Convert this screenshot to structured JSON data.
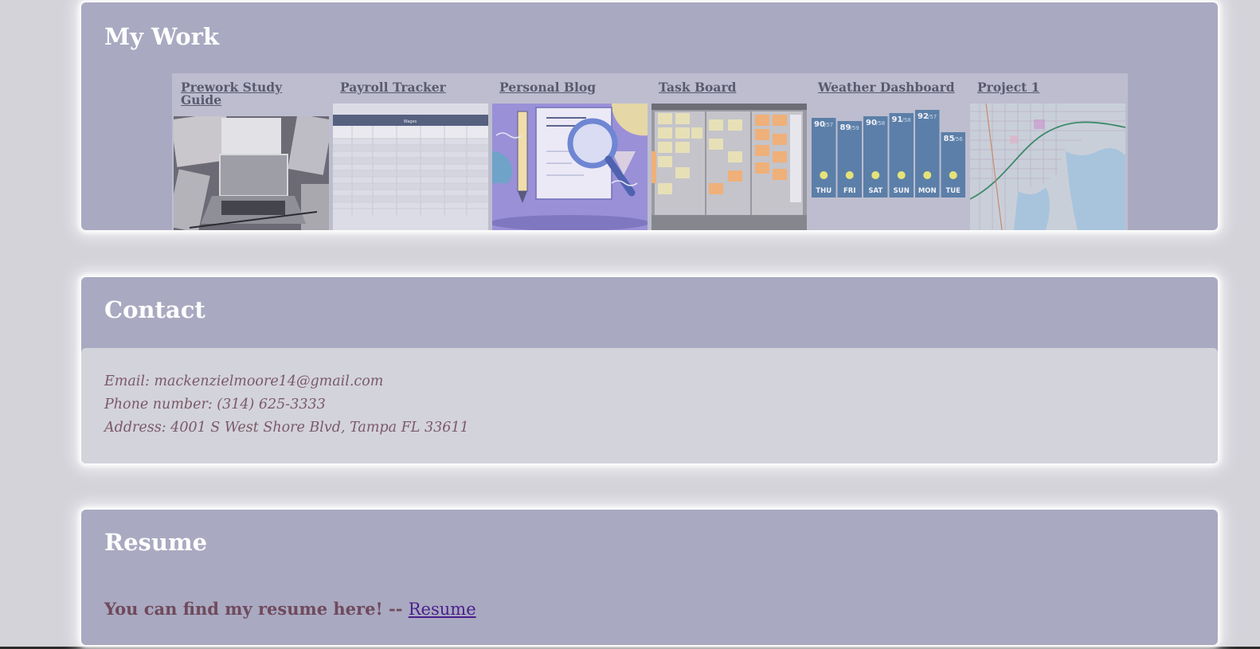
{
  "work": {
    "title": "My Work",
    "projects": [
      {
        "name": "Prework Study Guide",
        "thumb": "laptop-desk-photo"
      },
      {
        "name": "Payroll Tracker",
        "thumb": "spreadsheet-table"
      },
      {
        "name": "Personal Blog",
        "thumb": "document-magnifier-illustration"
      },
      {
        "name": "Task Board",
        "thumb": "sticky-notes-board-photo"
      },
      {
        "name": "Weather Dashboard",
        "thumb": "weather-forecast-bars"
      },
      {
        "name": "Project 1",
        "thumb": "city-map"
      }
    ],
    "payroll_header": "Wages",
    "weather": {
      "days": [
        "THU",
        "FRI",
        "SAT",
        "SUN",
        "MON",
        "TUE"
      ],
      "highs": [
        "90",
        "89",
        "90",
        "91",
        "92",
        "85"
      ],
      "lows": [
        "/57",
        "/59",
        "/58",
        "/58",
        "/57",
        "/56"
      ]
    }
  },
  "contact": {
    "title": "Contact",
    "email": "Email: mackenzielmoore14@gmail.com",
    "phone": "Phone number: (314) 625-3333",
    "address": "Address: 4001 S West Shore Blvd, Tampa FL 33611"
  },
  "resume": {
    "title": "Resume",
    "text": "You can find my resume here! -- ",
    "link_label": "Resume"
  },
  "colors": {
    "page_bg": "#d4d3da",
    "card_bg": "#a9a9c1",
    "contact_body_bg": "#d3d3dc",
    "link": "#4a1f8c"
  }
}
